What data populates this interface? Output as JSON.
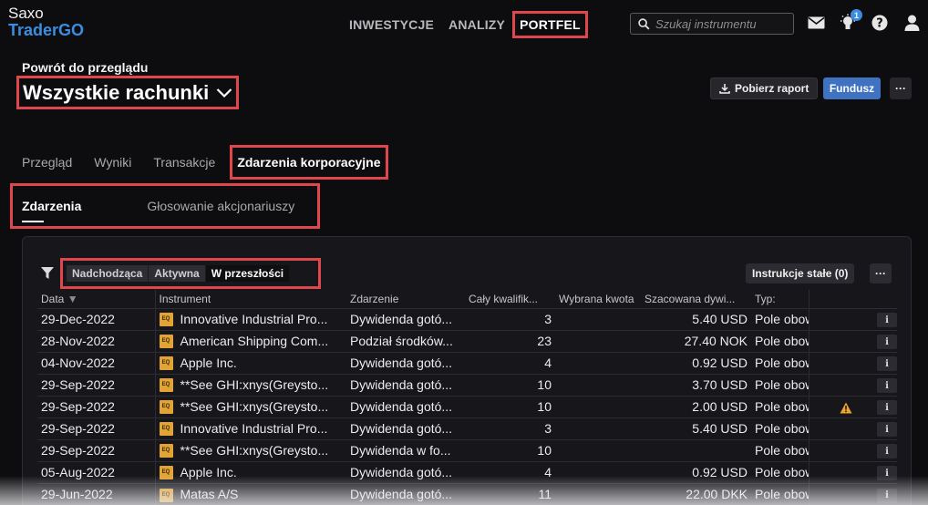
{
  "logo": {
    "line1": "Saxo",
    "line2": "TraderGO"
  },
  "topnav": [
    {
      "label": "INWESTYCJE",
      "name": "nav-inwestycje",
      "active": false
    },
    {
      "label": "ANALIZY",
      "name": "nav-analizy",
      "active": false
    },
    {
      "label": "PORTFEL",
      "name": "nav-portfel",
      "active": true
    }
  ],
  "search": {
    "placeholder": "Szukaj instrumentu",
    "value": ""
  },
  "notifications": {
    "count": "1"
  },
  "icons": [
    "mail-icon",
    "lightbulb-icon",
    "help-icon",
    "user-icon",
    "search-icon",
    "download-icon",
    "filter-icon",
    "chevron-down-icon",
    "info-icon",
    "warning-icon"
  ],
  "colors": {
    "accent": "#3b8de0",
    "highlight": "#e0474c",
    "fund_button": "#3f72c0",
    "eq_badge": "#e3a436",
    "warning": "#f0a030"
  },
  "header": {
    "back_link": "Powrót do przeglądu",
    "title": "Wszystkie rachunki",
    "report_button": "Pobierz raport",
    "fund_button": "Fundusz",
    "more_button": "···"
  },
  "tabs": [
    {
      "label": "Przegląd",
      "active": false
    },
    {
      "label": "Wyniki",
      "active": false
    },
    {
      "label": "Transakcje",
      "active": false
    },
    {
      "label": "Zdarzenia korporacyjne",
      "active": true
    }
  ],
  "subtabs": [
    {
      "label": "Zdarzenia",
      "active": true
    },
    {
      "label": "Głosowanie akcjonariuszy",
      "active": false
    }
  ],
  "segment": [
    {
      "label": "Nadchodząca",
      "selected": false
    },
    {
      "label": "Aktywna",
      "selected": false
    },
    {
      "label": "W przeszłości",
      "selected": true
    }
  ],
  "instructions_button": "Instrukcje stałe (0)",
  "more_button2": "···",
  "table": {
    "columns": [
      "Data",
      "Instrument",
      "Zdarzenie",
      "Cały kwalifik...",
      "Wybrana kwota",
      "Szacowana dywi...",
      "Typ:"
    ],
    "sort_indicator": "▼",
    "instrument_badge": "EQ",
    "info_label": "i",
    "rows": [
      {
        "date": "29-Dec-2022",
        "instrument": "Innovative Industrial Pro...",
        "event": "Dywidenda gotó...",
        "qty": "3",
        "chosen": "",
        "est": "5.40 USD",
        "type": "Pole obow",
        "warning": false
      },
      {
        "date": "28-Nov-2022",
        "instrument": "American Shipping Com...",
        "event": "Podział środków...",
        "qty": "23",
        "chosen": "",
        "est": "27.40 NOK",
        "type": "Pole obow",
        "warning": false
      },
      {
        "date": "04-Nov-2022",
        "instrument": "Apple Inc.",
        "event": "Dywidenda gotó...",
        "qty": "4",
        "chosen": "",
        "est": "0.92 USD",
        "type": "Pole obow",
        "warning": false
      },
      {
        "date": "29-Sep-2022",
        "instrument": "**See GHI:xnys(Greysto...",
        "event": "Dywidenda gotó...",
        "qty": "10",
        "chosen": "",
        "est": "3.70 USD",
        "type": "Pole obow",
        "warning": false
      },
      {
        "date": "29-Sep-2022",
        "instrument": "**See GHI:xnys(Greysto...",
        "event": "Dywidenda gotó...",
        "qty": "10",
        "chosen": "",
        "est": "2.00 USD",
        "type": "Pole obow",
        "warning": true
      },
      {
        "date": "29-Sep-2022",
        "instrument": "Innovative Industrial Pro...",
        "event": "Dywidenda gotó...",
        "qty": "3",
        "chosen": "",
        "est": "5.40 USD",
        "type": "Pole obow",
        "warning": false
      },
      {
        "date": "29-Sep-2022",
        "instrument": "**See GHI:xnys(Greysto...",
        "event": "Dywidenda w fo...",
        "qty": "10",
        "chosen": "",
        "est": "",
        "type": "Pole obow",
        "warning": false
      },
      {
        "date": "05-Aug-2022",
        "instrument": "Apple Inc.",
        "event": "Dywidenda gotó...",
        "qty": "4",
        "chosen": "",
        "est": "0.92 USD",
        "type": "Pole obow",
        "warning": false
      },
      {
        "date": "29-Jun-2022",
        "instrument": "Matas A/S",
        "event": "Dywidenda gotó...",
        "qty": "11",
        "chosen": "",
        "est": "22.00 DKK",
        "type": "Pole obow",
        "warning": false
      }
    ]
  }
}
